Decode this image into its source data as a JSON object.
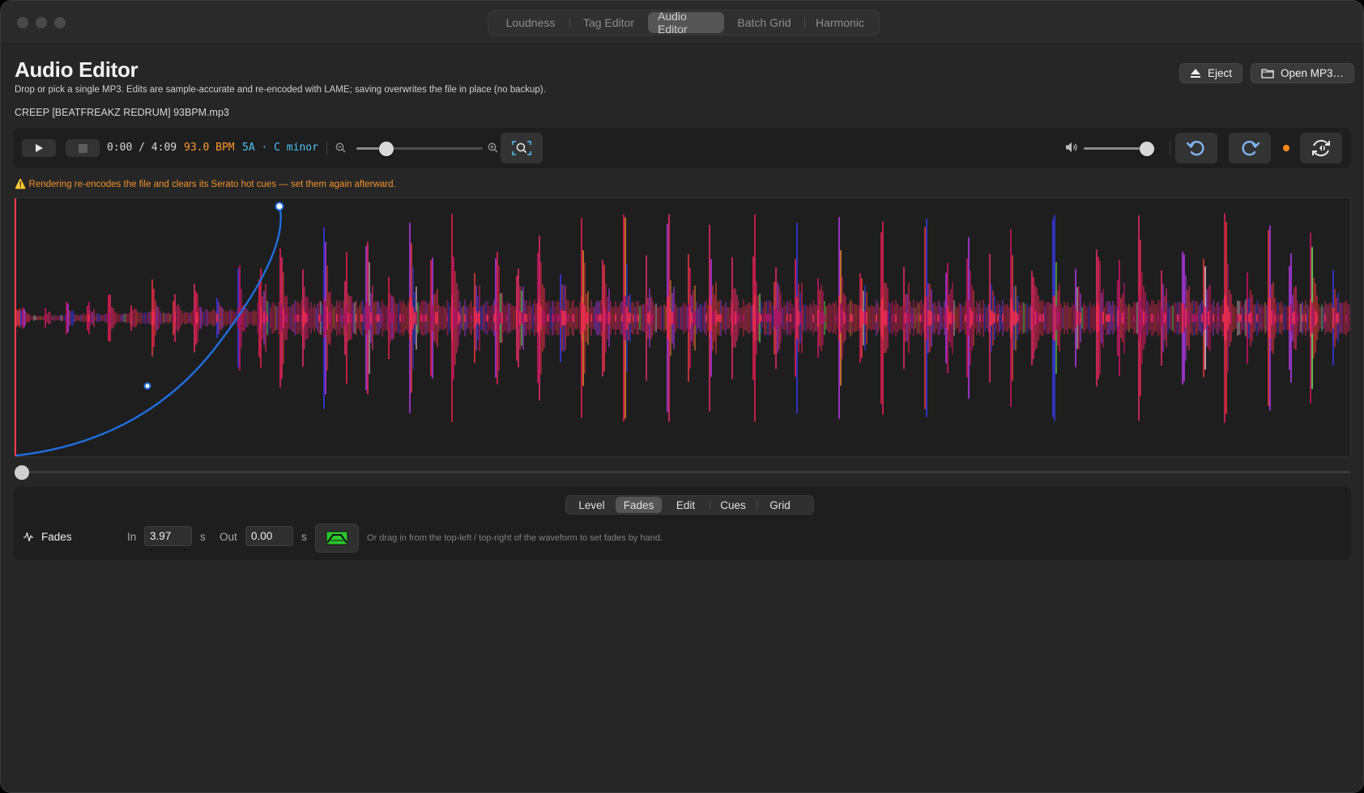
{
  "window": {
    "tabs": [
      {
        "label": "Loudness"
      },
      {
        "label": "Tag Editor"
      },
      {
        "label": "Audio Editor"
      },
      {
        "label": "Batch Grid"
      },
      {
        "label": "Harmonic"
      }
    ],
    "active_tab": "Audio Editor"
  },
  "header": {
    "title": "Audio Editor",
    "subtitle": "Drop or pick a single MP3. Edits are sample-accurate and re-encoded with LAME; saving overwrites the file in place (no backup).",
    "filename": "CREEP [BEATFREAKZ REDRUM] 93BPM.mp3",
    "eject_label": "Eject",
    "open_label": "Open MP3…"
  },
  "transport": {
    "time": "0:00 / 4:09",
    "bpm": "93.0 BPM",
    "key": "5A · C minor",
    "zoom_level": 0.2,
    "volume_level": 0.98,
    "unsaved_changes": true,
    "icons": {
      "play": "play-icon",
      "stop": "stop-icon",
      "zoom_out": "zoom-out-icon",
      "zoom_in": "zoom-in-icon",
      "zoom_fit": "zoom-to-fit-icon",
      "volume": "speaker-icon",
      "undo": "undo-icon",
      "redo": "redo-icon",
      "render": "render-icon"
    }
  },
  "warning": "⚠️ Rendering re-encodes the file and clears its Serato hot cues — set them again afterward.",
  "lower_panel": {
    "tabs": [
      {
        "label": "Level"
      },
      {
        "label": "Fades"
      },
      {
        "label": "Edit"
      },
      {
        "label": "Cues"
      },
      {
        "label": "Grid"
      }
    ],
    "active_tab": "Fades",
    "section_label": "Fades",
    "in_label": "In",
    "in_value": "3.97",
    "in_unit": "s",
    "out_label": "Out",
    "out_value": "0.00",
    "out_unit": "s",
    "hint": "Or drag in from the top-left / top-right of the waveform to set fades by hand."
  },
  "colors": {
    "accent_orange": "#f0932e",
    "bpm_orange": "#ff9a2e",
    "key_blue": "#4fc3f7",
    "fade_curve": "#1f6fe0",
    "playhead": "#ff3b4a"
  }
}
